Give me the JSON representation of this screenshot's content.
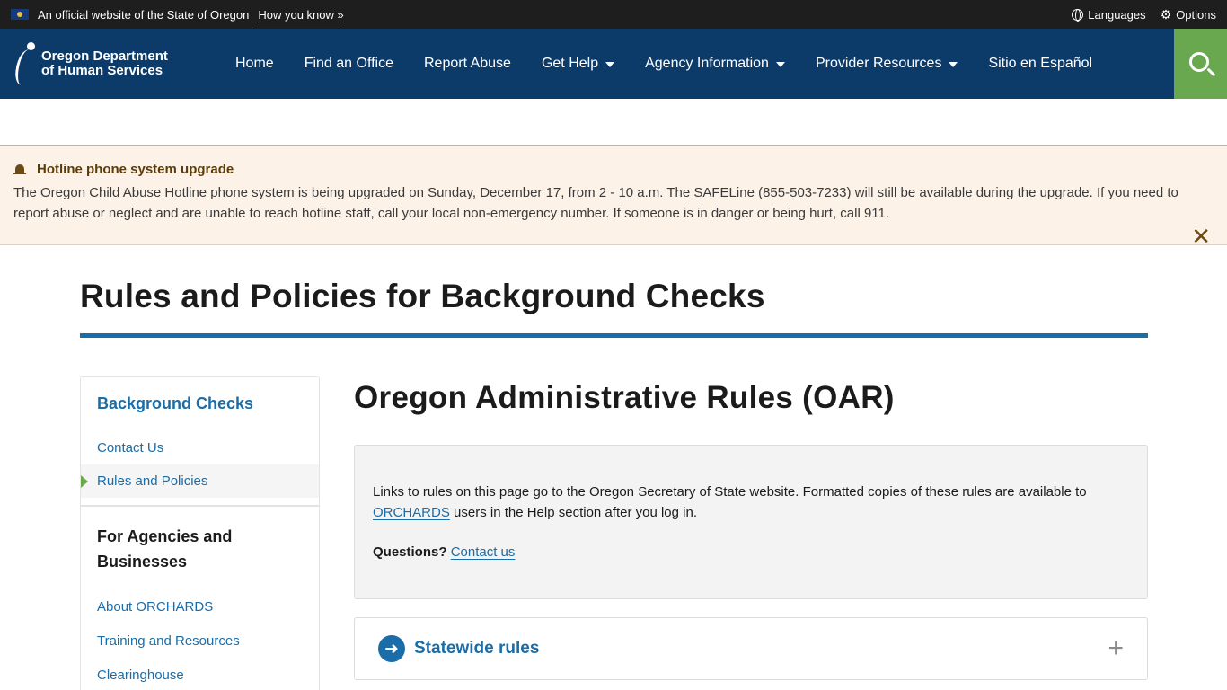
{
  "gov_banner": {
    "official_text": "An official website of the State of Oregon",
    "how_link": "How you know »",
    "languages": "Languages",
    "options": "Options"
  },
  "header": {
    "logo_line1": "Oregon Department",
    "logo_line2": "of Human Services",
    "nav": [
      {
        "label": "Home"
      },
      {
        "label": "Find an Office"
      },
      {
        "label": "Report Abuse"
      },
      {
        "label": "Get Help"
      },
      {
        "label": "Agency Information"
      },
      {
        "label": "Provider Resources"
      },
      {
        "label": "Sitio en Español"
      }
    ]
  },
  "alert": {
    "title": "Hotline phone system upgrade",
    "text": "The Oregon Child Abuse Hotline phone system is being upgraded on Sunday, December 17, from 2 - 10 a.m. The SAFELine (855-503-7233) will still be available during the upgrade. If you need to report abuse or neglect and are unable to reach hotline staff, call your local non-emergency number. If someone is in danger or being hurt, call 911.",
    "close": "✕"
  },
  "page": {
    "title": "Rules and Policies for Background Checks"
  },
  "sidebar": {
    "section_title": "Background Checks",
    "links": [
      {
        "label": "Contact Us"
      },
      {
        "label": "Rules and Policies"
      }
    ],
    "group_title": "For Agencies and Businesses",
    "group_links": [
      {
        "label": "About ORCHARDS"
      },
      {
        "label": "Training and Resources"
      },
      {
        "label": "Clearinghouse"
      }
    ]
  },
  "main": {
    "title": "Oregon Administrative Rules (OAR)",
    "info_text_before": "Links to rules on this page go to the Oregon Secretary of State website. Formatted copies of these rules are available to",
    "info_link": "ORCHARDS",
    "info_text_after": "users in the Help section after you log in.",
    "questions_label": "Questions?",
    "questions_link": "Contact us",
    "accordion_title": "Statewide rules"
  },
  "colors": {
    "header_bg": "#0c3b6a",
    "search_bg": "#6aa84f",
    "link": "#1a6da8",
    "alert_bg": "#fdf2e7"
  }
}
